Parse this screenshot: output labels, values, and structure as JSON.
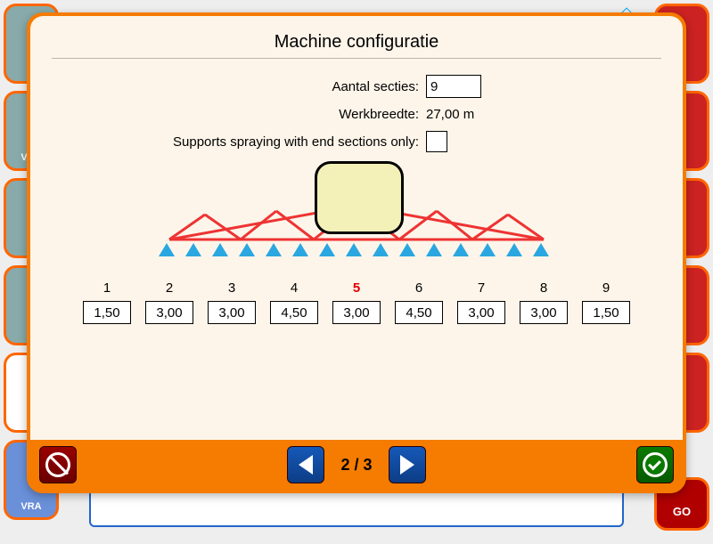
{
  "background": {
    "vra_label": "VRA",
    "go_label": "GO"
  },
  "modal": {
    "title": "Machine configuratie",
    "fields": {
      "sections_label": "Aantal secties:",
      "sections_value": "9",
      "width_label": "Werkbreedte:",
      "width_value": "27,00 m",
      "end_sections_label": "Supports spraying with end sections only:"
    },
    "sections": [
      {
        "num": "1",
        "val": "1,50"
      },
      {
        "num": "2",
        "val": "3,00"
      },
      {
        "num": "3",
        "val": "3,00"
      },
      {
        "num": "4",
        "val": "4,50"
      },
      {
        "num": "5",
        "val": "3,00",
        "center": true
      },
      {
        "num": "6",
        "val": "4,50"
      },
      {
        "num": "7",
        "val": "3,00"
      },
      {
        "num": "8",
        "val": "3,00"
      },
      {
        "num": "9",
        "val": "1,50"
      }
    ],
    "footer": {
      "page_indicator": "2 / 3"
    }
  }
}
